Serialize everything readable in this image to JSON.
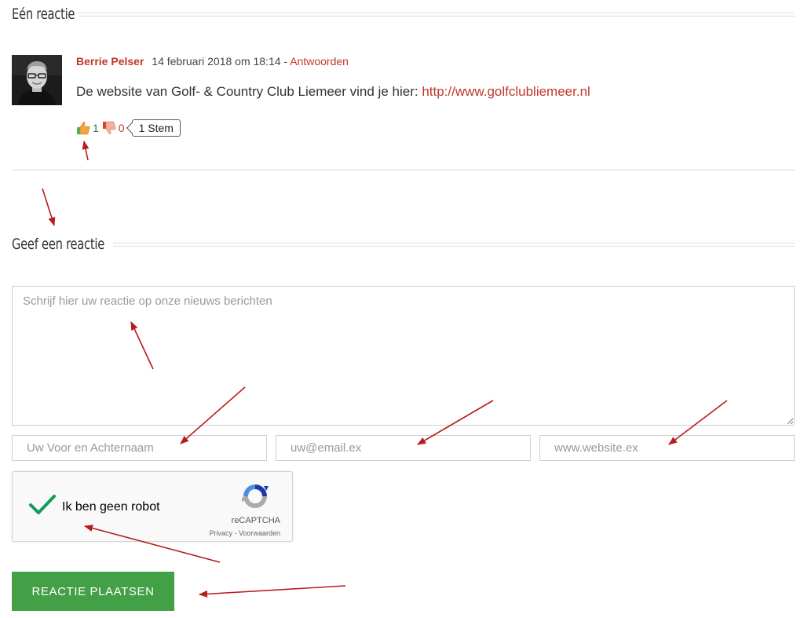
{
  "comments_section": {
    "heading": "Eén reactie"
  },
  "comment": {
    "author": "Berrie Pelser",
    "date": "14 februari 2018 om 18:14",
    "separator": "-",
    "reply_label": "Antwoorden",
    "text_prefix": "De website van Golf- & Country Club Liemeer vind je hier: ",
    "link_text": "http://www.golfclubliemeer.nl",
    "votes": {
      "up_count": "1",
      "down_count": "0",
      "total_label": "1 Stem"
    }
  },
  "reply_form": {
    "heading": "Geef een reactie",
    "comment_placeholder": "Schrijf hier uw reactie op onze nieuws berichten",
    "name_placeholder": "Uw Voor en Achternaam",
    "email_placeholder": "uw@email.ex",
    "website_placeholder": "www.website.ex",
    "recaptcha": {
      "label": "Ik ben geen robot",
      "brand": "reCAPTCHA",
      "privacy": "Privacy",
      "links_separator": " - ",
      "terms": "Voorwaarden"
    },
    "submit_label": "REACTIE PLAATSEN"
  },
  "colors": {
    "accent_red": "#c0392b",
    "submit_green": "#43a047",
    "annotation_arrow": "#b71c1c"
  },
  "icons": [
    "avatar-photo",
    "thumbs-up-icon",
    "thumbs-down-icon",
    "recaptcha-check-icon",
    "recaptcha-logo-icon",
    "annotation-arrow"
  ]
}
